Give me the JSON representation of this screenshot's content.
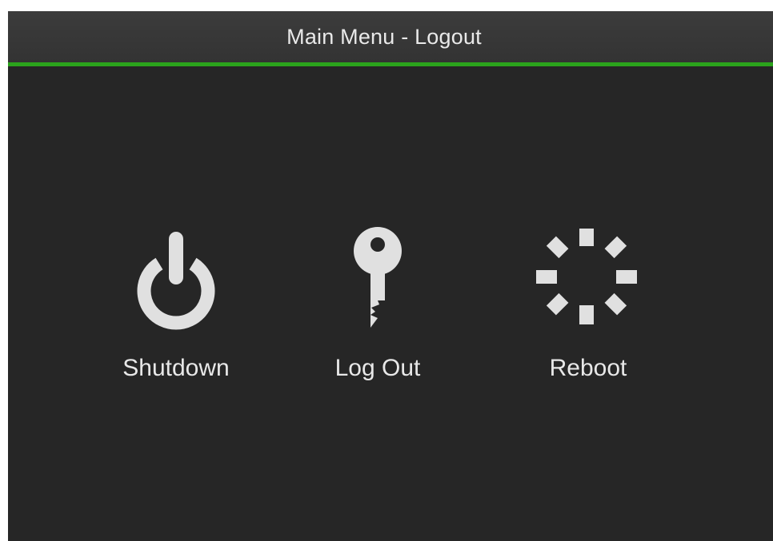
{
  "window": {
    "title": "Main Menu - Logout"
  },
  "options": [
    {
      "label": "Shutdown",
      "icon": "power-icon"
    },
    {
      "label": "Log Out",
      "icon": "key-icon"
    },
    {
      "label": "Reboot",
      "icon": "reboot-spinner-icon"
    }
  ],
  "colors": {
    "background": "#262626",
    "title_bar": "#383838",
    "accent": "#2ba31c",
    "icon": "#e0e0e0",
    "text": "#e8e8e8"
  }
}
